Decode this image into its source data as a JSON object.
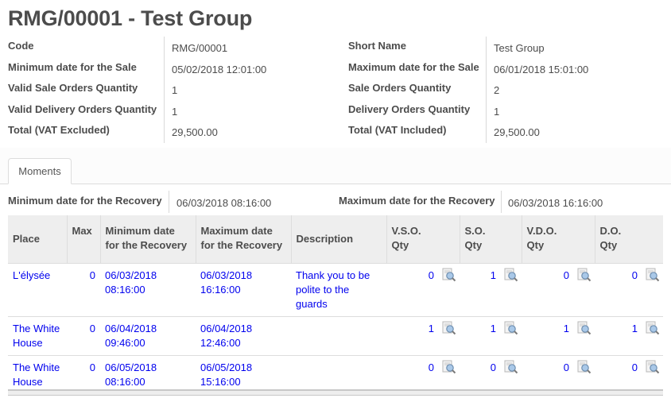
{
  "title": "RMG/00001 - Test Group",
  "info": {
    "left": [
      {
        "label": "Code",
        "value": "RMG/00001"
      },
      {
        "label": "Minimum date for the Sale",
        "value": "05/02/2018 12:01:00"
      },
      {
        "label": "Valid Sale Orders Quantity",
        "value": "1"
      },
      {
        "label": "Valid Delivery Orders Quantity",
        "value": "1"
      },
      {
        "label": "Total (VAT Excluded)",
        "value": "29,500.00"
      }
    ],
    "right": [
      {
        "label": "Short Name",
        "value": "Test Group"
      },
      {
        "label": "Maximum date for the Sale",
        "value": "06/01/2018 15:01:00"
      },
      {
        "label": "Sale Orders Quantity",
        "value": "2"
      },
      {
        "label": "Delivery Orders Quantity",
        "value": "1"
      },
      {
        "label": "Total (VAT Included)",
        "value": "29,500.00"
      }
    ]
  },
  "tabs": [
    {
      "label": "Moments",
      "active": true
    }
  ],
  "recovery": {
    "min_label": "Minimum date for the Recovery",
    "min_value": "06/03/2018 08:16:00",
    "max_label": "Maximum date for the Recovery",
    "max_value": "06/03/2018 16:16:00"
  },
  "table": {
    "headers": {
      "place": "Place",
      "max": "Max",
      "min_date_1": "Minimum date",
      "min_date_2": "for the Recovery",
      "max_date_1": "Maximum date",
      "max_date_2": "for the Recovery",
      "description": "Description",
      "vso_1": "V.S.O.",
      "vso_2": "Qty",
      "so_1": "S.O.",
      "so_2": "Qty",
      "vdo_1": "V.D.O.",
      "vdo_2": "Qty",
      "do_1": "D.O.",
      "do_2": "Qty"
    },
    "rows": [
      {
        "place": "L'élysée",
        "max": "0",
        "min_date": "06/03/2018",
        "min_time": "08:16:00",
        "max_date": "06/03/2018",
        "max_time": "16:16:00",
        "description": "Thank you to be polite to the guards",
        "vso": "0",
        "so": "1",
        "vdo": "0",
        "do": "0"
      },
      {
        "place": "The White House",
        "max": "0",
        "min_date": "06/04/2018",
        "min_time": "09:46:00",
        "max_date": "06/04/2018",
        "max_time": "12:46:00",
        "description": "",
        "vso": "1",
        "so": "1",
        "vdo": "1",
        "do": "1"
      },
      {
        "place": "The White House",
        "max": "0",
        "min_date": "06/05/2018",
        "min_time": "08:16:00",
        "max_date": "06/05/2018",
        "max_time": "15:16:00",
        "description": "",
        "vso": "0",
        "so": "0",
        "vdo": "0",
        "do": "0"
      }
    ],
    "row_action_icon": "magnifier-document-icon"
  },
  "colors": {
    "link": "#0000ee",
    "text": "#4c4c4c",
    "header_bg": "#eeeeee",
    "border": "#dddddd"
  }
}
